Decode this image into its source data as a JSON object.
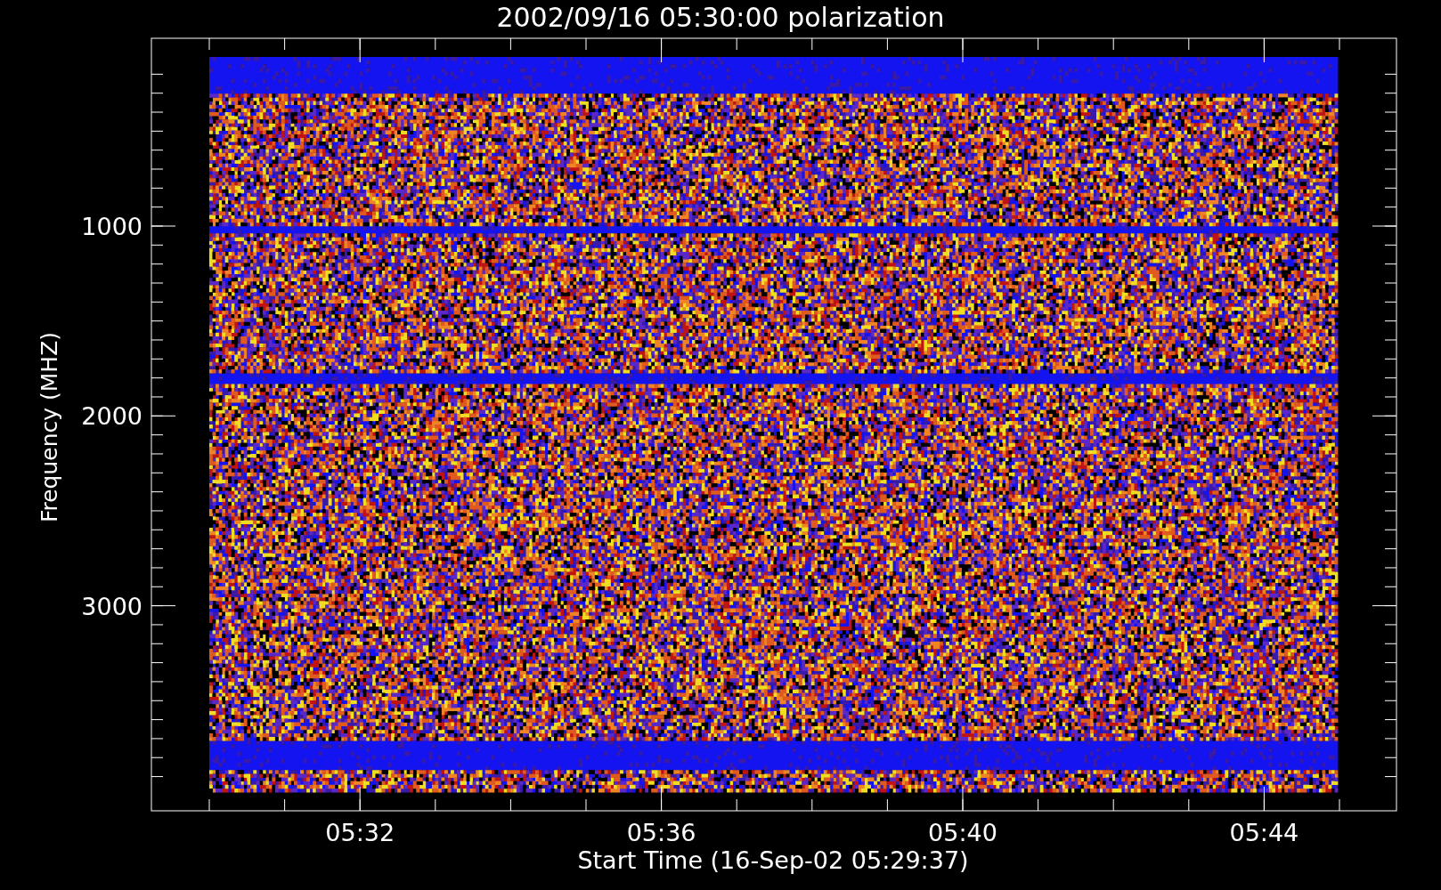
{
  "title": "2002/09/16 05:30:00 polarization",
  "y_axis": {
    "label": "Frequency (MHZ)",
    "ticks": [
      "1000",
      "2000",
      "3000"
    ]
  },
  "x_axis": {
    "label": "Start Time (16-Sep-02 05:29:37)",
    "ticks": [
      "05:32",
      "05:36",
      "05:40",
      "05:44"
    ]
  }
}
